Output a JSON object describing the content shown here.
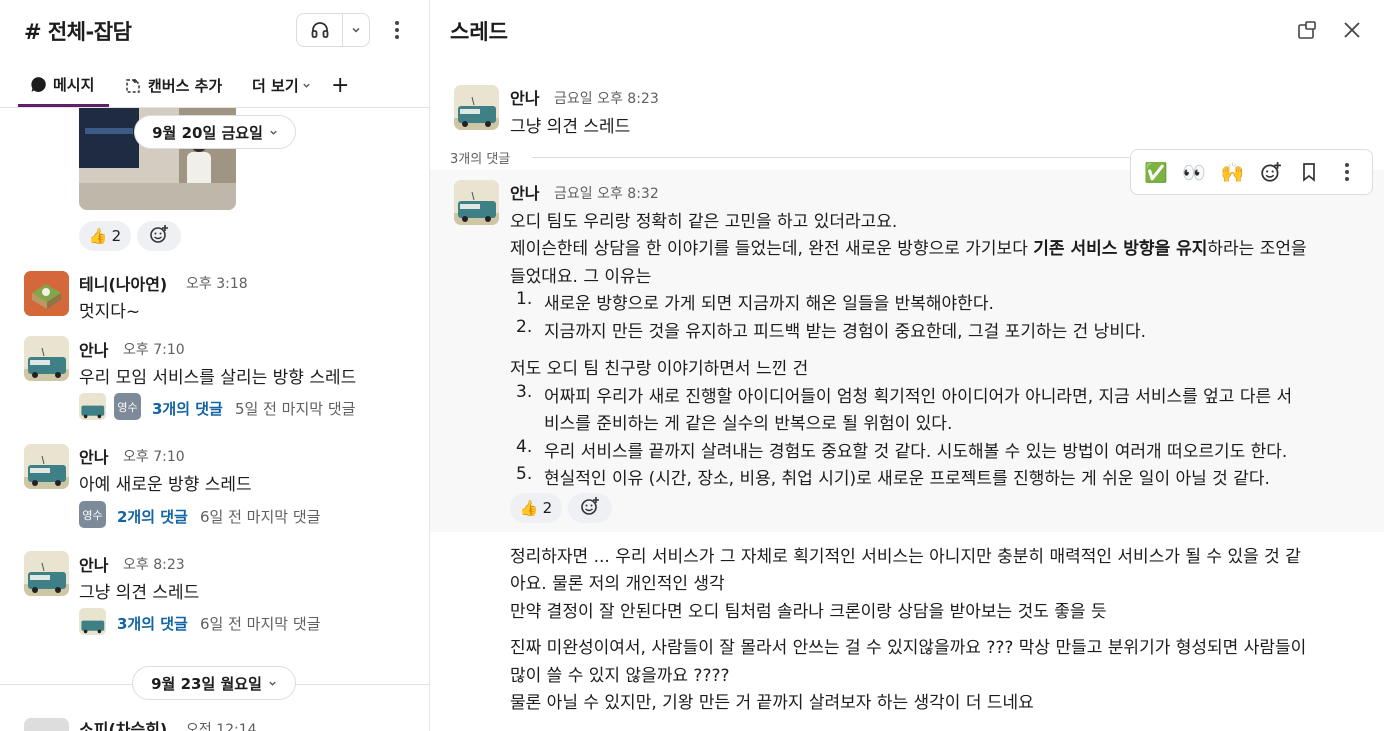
{
  "channel": {
    "title": "# 전체-잡담",
    "tabs": [
      {
        "label": "메시지",
        "icon": "message-icon"
      },
      {
        "label": "캔버스 추가",
        "icon": "canvas-add-icon"
      },
      {
        "label": "더 보기",
        "icon": "chevron-down-icon"
      }
    ],
    "add_tab": "+",
    "date_pills": [
      "9월 20일 금요일",
      "9월 23일 월요일"
    ],
    "top_reaction": {
      "emoji": "👍",
      "count": "2"
    },
    "messages": [
      {
        "author": "테니(나아연)",
        "time": "오후 3:18",
        "text": "멋지다~"
      },
      {
        "author": "안나",
        "time": "오후 7:10",
        "text": "우리 모임 서비스를 살리는 방향 스레드",
        "replier": "영수",
        "replies": "3개의 댓글",
        "last_reply": "5일 전 마지막 댓글"
      },
      {
        "author": "안나",
        "time": "오후 7:10",
        "text": "아예 새로운 방향 스레드",
        "replier": "영수",
        "replies": "2개의 댓글",
        "last_reply": "6일 전 마지막 댓글"
      },
      {
        "author": "안나",
        "time": "오후 8:23",
        "text": "그냥 의견 스레드",
        "replies": "3개의 댓글",
        "last_reply": "6일 전 마지막 댓글"
      }
    ],
    "partial_author": "소피(차승희)",
    "partial_time": "오전 12:14"
  },
  "thread": {
    "title": "스레드",
    "parent": {
      "author": "안나",
      "time": "금요일 오후 8:23",
      "text": "그냥 의견 스레드"
    },
    "reply_count": "3개의 댓글",
    "actions": [
      "✅",
      "👀",
      "🙌"
    ],
    "reply1": {
      "author": "안나",
      "time": "금요일 오후 8:32",
      "line1": "오디 팀도 우리랑 정확히 같은 고민을 하고 있더라고요.",
      "line2_a": "제이슨한테 상담을 한 이야기를 들었는데, 완전 새로운 방향으로 가기보다 ",
      "line2_bold": "기존 서비스 방향을 유지",
      "line2_b": "하라는 조언을",
      "line3": "들었대요. 그 이유는",
      "list1": [
        {
          "n": "1.",
          "t": "새로운 방향으로 가게 되면 지금까지 해온 일들을 반복해야한다."
        },
        {
          "n": "2.",
          "t": "지금까지 만든 것을 유지하고 피드백 받는 경험이 중요한데, 그걸 포기하는 건 낭비다."
        }
      ],
      "mid": "저도 오디 팀 친구랑 이야기하면서 느낀 건",
      "list2": [
        {
          "n": "3.",
          "t": "어짜피 우리가 새로 진행할 아이디어들이 엄청 획기적인 아이디어가 아니라면, 지금 서비스를 엎고 다른 서",
          "t2": "비스를 준비하는 게 같은 실수의 반복으로 될 위험이 있다."
        },
        {
          "n": "4.",
          "t": "우리 서비스를 끝까지 살려내는 경험도 중요할 것 같다. 시도해볼 수 있는 방법이 여러개 떠오르기도 한다."
        },
        {
          "n": "5.",
          "t": "현실적인 이유 (시간, 장소, 비용, 취업 시기)로 새로운 프로젝트를 진행하는 게 쉬운 일이 아닐 것 같다."
        }
      ],
      "reaction": {
        "emoji": "👍",
        "count": "2"
      }
    },
    "reply2": [
      "정리하자면 ... 우리 서비스가 그 자체로 획기적인 서비스는 아니지만 충분히 매력적인 서비스가 될 수 있을 것 같",
      "아요. 물론 저의 개인적인 생각",
      "만약 결정이 잘 안된다면 오디 팀처럼 솔라나 크론이랑 상담을 받아보는 것도 좋을 듯"
    ],
    "reply3": [
      "진짜 미완성이여서, 사람들이 잘 몰라서 안쓰는 걸 수 있지않을까요 ??? 막상 만들고 분위기가 형성되면 사람들이",
      "많이 쓸 수 있지 않을까요 ????",
      "물론 아닐 수 있지만, 기왕 만든 거 끝까지 살려보자 하는 생각이 더 드네요"
    ]
  }
}
